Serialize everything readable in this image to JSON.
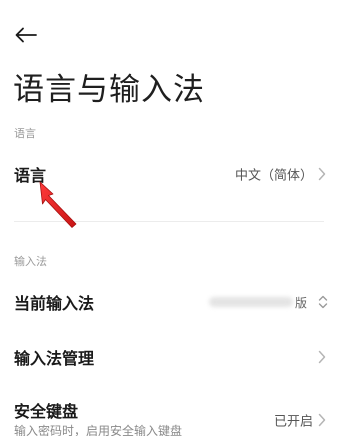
{
  "header": {
    "back_icon": "arrow-left-icon",
    "title": "语言与输入法"
  },
  "sections": {
    "language": {
      "header": "语言",
      "row": {
        "label": "语言",
        "value": "中文（简体）",
        "icon": "chevron-right-icon"
      }
    },
    "input": {
      "header": "输入法",
      "current": {
        "label": "当前输入法",
        "value_visible_char": "版",
        "icon": "up-down-chevron-icon"
      },
      "manage": {
        "label": "输入法管理",
        "icon": "chevron-right-icon"
      },
      "secure_keyboard": {
        "label": "安全键盘",
        "sublabel": "输入密码时，启用安全输入键盘",
        "value": "已开启",
        "icon": "chevron-right-icon"
      }
    }
  },
  "annotation": {
    "icon": "red-pointer-arrow-icon",
    "color": "#e02020"
  }
}
